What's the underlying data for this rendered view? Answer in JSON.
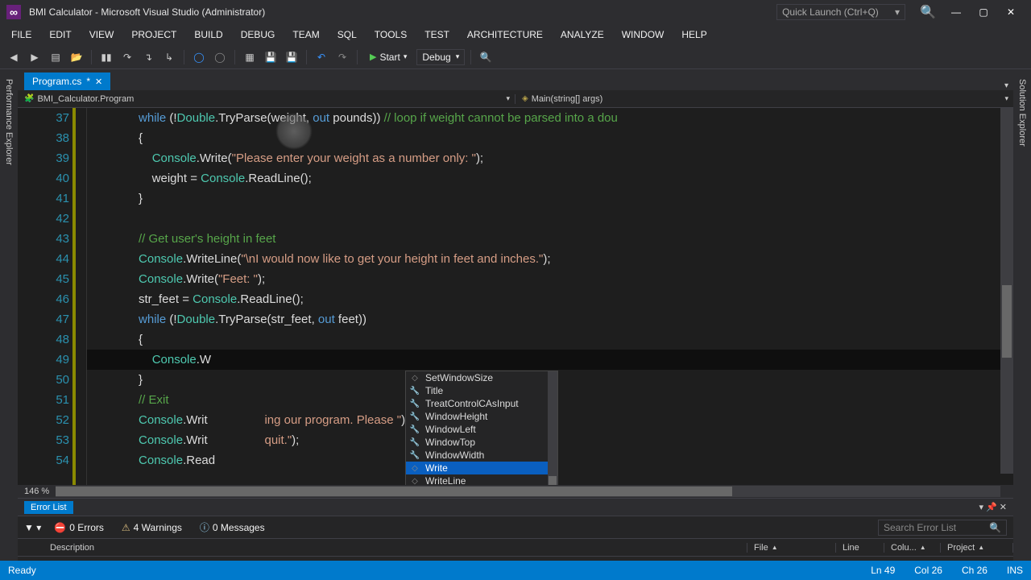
{
  "window": {
    "title": "BMI Calculator - Microsoft Visual Studio (Administrator)",
    "quick_launch": "Quick Launch (Ctrl+Q)"
  },
  "menu": [
    "FILE",
    "EDIT",
    "VIEW",
    "PROJECT",
    "BUILD",
    "DEBUG",
    "TEAM",
    "SQL",
    "TOOLS",
    "TEST",
    "ARCHITECTURE",
    "ANALYZE",
    "WINDOW",
    "HELP"
  ],
  "toolbar": {
    "start": "Start",
    "config": "Debug"
  },
  "rails": {
    "left": "Performance Explorer",
    "right": "Solution Explorer"
  },
  "file_tab": {
    "name": "Program.cs",
    "dirty": "*"
  },
  "nav": {
    "class": "BMI_Calculator.Program",
    "method": "Main(string[] args)"
  },
  "code": {
    "first_line": 37,
    "lines": [
      {
        "n": 37,
        "seg": [
          [
            "            ",
            "id"
          ],
          [
            "while",
            " kw"
          ],
          [
            " (!",
            "id"
          ],
          [
            "Double",
            " type"
          ],
          [
            ".TryParse(weight, ",
            "id"
          ],
          [
            "out",
            " kw"
          ],
          [
            " pounds)) ",
            "id"
          ],
          [
            "// loop if weight cannot be parsed into a dou",
            " cmd"
          ]
        ]
      },
      {
        "n": 38,
        "seg": [
          [
            "            {",
            "id"
          ]
        ]
      },
      {
        "n": 39,
        "seg": [
          [
            "                ",
            "id"
          ],
          [
            "Console",
            " type"
          ],
          [
            ".Write(",
            "id"
          ],
          [
            "\"Please enter your weight as a number only: \"",
            " str"
          ],
          [
            ");",
            "id"
          ]
        ]
      },
      {
        "n": 40,
        "seg": [
          [
            "                weight = ",
            "id"
          ],
          [
            "Console",
            " type"
          ],
          [
            ".ReadLine();",
            "id"
          ]
        ]
      },
      {
        "n": 41,
        "seg": [
          [
            "            }",
            "id"
          ]
        ]
      },
      {
        "n": 42,
        "seg": [
          [
            "",
            "id"
          ]
        ]
      },
      {
        "n": 43,
        "seg": [
          [
            "            ",
            "id"
          ],
          [
            "// Get user's height in feet",
            " cmd"
          ]
        ]
      },
      {
        "n": 44,
        "seg": [
          [
            "            ",
            "id"
          ],
          [
            "Console",
            " type"
          ],
          [
            ".WriteLine(",
            "id"
          ],
          [
            "\"\\nI would now like to get your height in feet and inches.\"",
            " str"
          ],
          [
            ");",
            "id"
          ]
        ]
      },
      {
        "n": 45,
        "seg": [
          [
            "            ",
            "id"
          ],
          [
            "Console",
            " type"
          ],
          [
            ".Write(",
            "id"
          ],
          [
            "\"Feet: \"",
            " str"
          ],
          [
            ");",
            "id"
          ]
        ]
      },
      {
        "n": 46,
        "seg": [
          [
            "            str_feet = ",
            "id"
          ],
          [
            "Console",
            " type"
          ],
          [
            ".ReadLine();",
            "id"
          ]
        ]
      },
      {
        "n": 47,
        "seg": [
          [
            "            ",
            "id"
          ],
          [
            "while",
            " kw"
          ],
          [
            " (!",
            "id"
          ],
          [
            "Double",
            " type"
          ],
          [
            ".TryParse(str_feet, ",
            "id"
          ],
          [
            "out",
            " kw"
          ],
          [
            " feet))",
            "id"
          ]
        ]
      },
      {
        "n": 48,
        "seg": [
          [
            "            {",
            "id"
          ]
        ]
      },
      {
        "n": 49,
        "current": true,
        "seg": [
          [
            "                ",
            "id"
          ],
          [
            "Console",
            " type"
          ],
          [
            ".W",
            "id"
          ]
        ]
      },
      {
        "n": 50,
        "seg": [
          [
            "            }",
            "id"
          ]
        ]
      },
      {
        "n": 51,
        "seg": [
          [
            "            ",
            "id"
          ],
          [
            "// Exit",
            " cmd"
          ]
        ]
      },
      {
        "n": 52,
        "seg": [
          [
            "            ",
            "id"
          ],
          [
            "Console",
            " type"
          ],
          [
            ".Writ",
            "id"
          ],
          [
            "                 ing our program. Please \"",
            " str"
          ],
          [
            ");",
            "id"
          ]
        ]
      },
      {
        "n": 53,
        "seg": [
          [
            "            ",
            "id"
          ],
          [
            "Console",
            " type"
          ],
          [
            ".Writ",
            "id"
          ],
          [
            "                 quit.\"",
            " str"
          ],
          [
            ");",
            "id"
          ]
        ]
      },
      {
        "n": 54,
        "seg": [
          [
            "            ",
            "id"
          ],
          [
            "Console",
            " type"
          ],
          [
            ".Read",
            "id"
          ]
        ]
      }
    ]
  },
  "intellisense": [
    {
      "icon": "◇",
      "label": "SetWindowSize"
    },
    {
      "icon": "🔧",
      "label": "Title"
    },
    {
      "icon": "🔧",
      "label": "TreatControlCAsInput"
    },
    {
      "icon": "🔧",
      "label": "WindowHeight"
    },
    {
      "icon": "🔧",
      "label": "WindowLeft"
    },
    {
      "icon": "🔧",
      "label": "WindowTop"
    },
    {
      "icon": "🔧",
      "label": "WindowWidth"
    },
    {
      "icon": "◇",
      "label": "Write",
      "sel": true
    },
    {
      "icon": "◇",
      "label": "WriteLine"
    }
  ],
  "zoom": "146 %",
  "error_list": {
    "title": "Error List",
    "errors": "0 Errors",
    "warnings": "4 Warnings",
    "messages": "0 Messages",
    "search": "Search Error List",
    "cols": {
      "desc": "Description",
      "file": "File",
      "line": "Line",
      "col": "Colu...",
      "proj": "Project"
    }
  },
  "status": {
    "ready": "Ready",
    "ln": "Ln 49",
    "col": "Col 26",
    "ch": "Ch 26",
    "ins": "INS"
  }
}
